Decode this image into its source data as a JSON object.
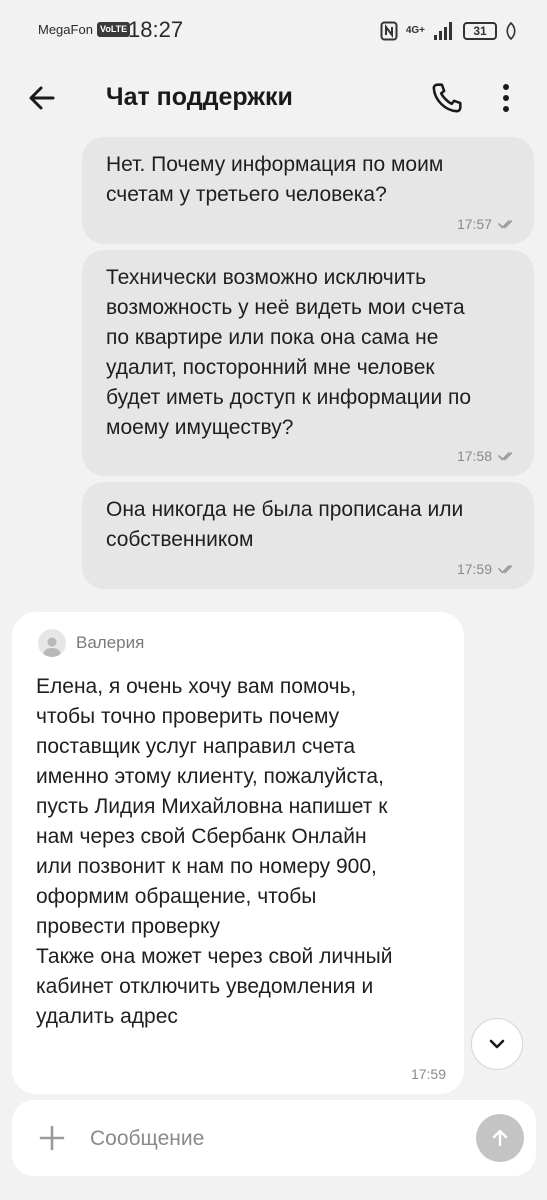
{
  "status_bar": {
    "carrier": "MegaFon",
    "volte": "VoLTE",
    "time": "18:27",
    "network": "4G+",
    "battery": "31",
    "icons": [
      "nfc-icon",
      "signal-icon",
      "battery-icon",
      "leaf-icon"
    ]
  },
  "header": {
    "title": "Чат поддержки",
    "icons": [
      "arrow-left-icon",
      "phone-icon",
      "more-vertical-icon"
    ]
  },
  "messages": [
    {
      "direction": "outgoing",
      "text": "Нет. Почему информация по моим\nсчетам у третьего человека?",
      "time": "17:57",
      "status_icon": "double-check-icon"
    },
    {
      "direction": "outgoing",
      "text": "Технически возможно исключить\nвозможность у неё видеть мои счета\nпо квартире или пока она сама не\nудалит, посторонний мне человек\nбудет иметь доступ к информации по\nмоему имуществу?",
      "time": "17:58",
      "status_icon": "double-check-icon"
    },
    {
      "direction": "outgoing",
      "text": "Она никогда не была прописана или\nсобственником",
      "time": "17:59",
      "status_icon": "double-check-icon"
    },
    {
      "direction": "incoming",
      "sender": "Валерия",
      "text": "Елена, я очень хочу вам помочь,\nчтобы точно проверить почему\nпоставщик услуг направил счета\nименно этому клиенту, пожалуйста,\nпусть Лидия Михайловна напишет к\nнам через свой Сбербанк Онлайн\nили позвонит к нам по номеру 900,\nоформим обращение, чтобы\nпровести проверку\nТакже она может через свой личный\nкабинет отключить уведомления и\nудалить адрес",
      "time": "17:59"
    }
  ],
  "composer": {
    "placeholder": "Сообщение",
    "icons": [
      "plus-icon",
      "arrow-up-icon"
    ]
  },
  "scroll_button_icon": "chevron-down-icon"
}
